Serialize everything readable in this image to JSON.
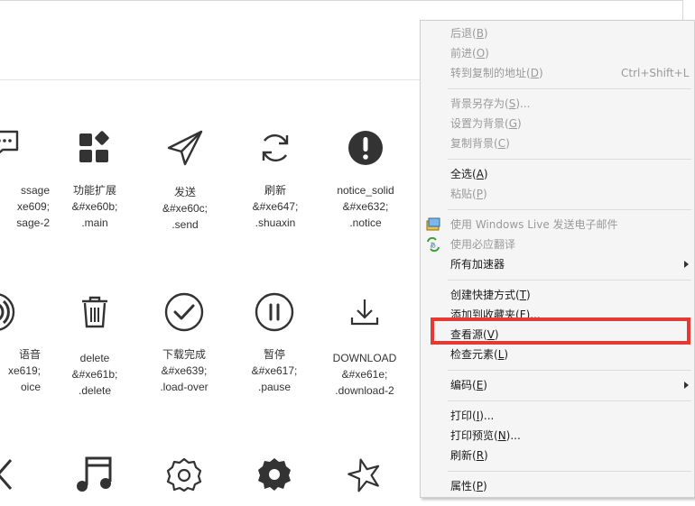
{
  "icons": [
    {
      "row": 0,
      "label": "ssage",
      "code": "xe609;",
      "cls": "sage-2",
      "icon": "message-icon"
    },
    {
      "row": 0,
      "label": "功能扩展",
      "code": "&#xe60b;",
      "cls": ".main",
      "icon": "grid-icon"
    },
    {
      "row": 0,
      "label": "发送",
      "code": "&#xe60c;",
      "cls": ".send",
      "icon": "send-icon"
    },
    {
      "row": 0,
      "label": "刷新",
      "code": "&#xe647;",
      "cls": ".shuaxin",
      "icon": "refresh-icon"
    },
    {
      "row": 0,
      "label": "notice_solid",
      "code": "&#xe632;",
      "cls": ".notice",
      "icon": "notice-icon"
    },
    {
      "row": 1,
      "label": "语音",
      "code": "xe619;",
      "cls": "oice",
      "icon": "voice-icon"
    },
    {
      "row": 1,
      "label": "delete",
      "code": "&#xe61b;",
      "cls": ".delete",
      "icon": "trash-icon"
    },
    {
      "row": 1,
      "label": "下载完成",
      "code": "&#xe639;",
      "cls": ".load-over",
      "icon": "check-circle-icon"
    },
    {
      "row": 1,
      "label": "暂停",
      "code": "&#xe617;",
      "cls": ".pause",
      "icon": "pause-icon"
    },
    {
      "row": 1,
      "label": "DOWNLOAD",
      "code": "&#xe61e;",
      "cls": ".download-2",
      "icon": "download-icon"
    },
    {
      "row": 2,
      "label": "",
      "code": "",
      "cls": "",
      "icon": "chevron-left-icon"
    },
    {
      "row": 2,
      "label": "",
      "code": "",
      "cls": "",
      "icon": "music-icon"
    },
    {
      "row": 2,
      "label": "",
      "code": "",
      "cls": "",
      "icon": "settings-outline-icon"
    },
    {
      "row": 2,
      "label": "",
      "code": "",
      "cls": "",
      "icon": "settings-solid-icon"
    },
    {
      "row": 2,
      "label": "",
      "code": "",
      "cls": "",
      "icon": "star-icon"
    }
  ],
  "menu": {
    "back": {
      "text": "后退(",
      "key": "B",
      "end": ")"
    },
    "forward": {
      "text": "前进(",
      "key": "O",
      "end": ")"
    },
    "goto_copied": {
      "text": "转到复制的地址(",
      "key": "D",
      "end": ")",
      "shortcut": "Ctrl+Shift+L"
    },
    "save_bg": {
      "text": "背景另存为(",
      "key": "S",
      "end": ")..."
    },
    "set_bg": {
      "text": "设置为背景(",
      "key": "G",
      "end": ")"
    },
    "copy_bg": {
      "text": "复制背景(",
      "key": "C",
      "end": ")"
    },
    "select_all": {
      "text": "全选(",
      "key": "A",
      "end": ")"
    },
    "paste": {
      "text": "粘贴(",
      "key": "P",
      "end": ")"
    },
    "email_live": {
      "text": "使用 Windows Live 发送电子邮件"
    },
    "translate": {
      "text": "使用必应翻译"
    },
    "accelerators": {
      "text": "所有加速器"
    },
    "shortcut": {
      "text": "创建快捷方式(",
      "key": "T",
      "end": ")"
    },
    "favorites": {
      "text": "添加到收藏夹(",
      "key": "F",
      "end": ")..."
    },
    "view_source": {
      "text": "查看源(",
      "key": "V",
      "end": ")"
    },
    "inspect": {
      "text": "检查元素(",
      "key": "L",
      "end": ")"
    },
    "encoding": {
      "text": "编码(",
      "key": "E",
      "end": ")"
    },
    "print": {
      "text": "打印(",
      "key": "I",
      "end": ")..."
    },
    "print_preview": {
      "text": "打印预览(",
      "key": "N",
      "end": ")..."
    },
    "refresh": {
      "text": "刷新(",
      "key": "R",
      "end": ")"
    },
    "properties": {
      "text": "属性(",
      "key": "P",
      "end": ")"
    }
  },
  "colors": {
    "highlight": "#e53935",
    "icon": "#333333",
    "disabled": "#9a9a9a"
  }
}
